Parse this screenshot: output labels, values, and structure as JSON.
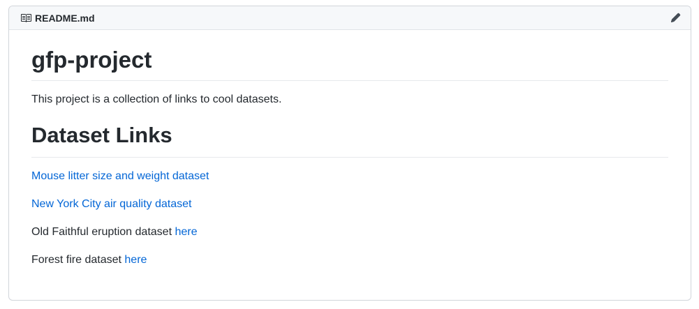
{
  "header": {
    "filename": "README.md",
    "icons": {
      "file": "book-icon",
      "edit": "pencil-icon"
    }
  },
  "readme": {
    "title": "gfp-project",
    "intro": "This project is a collection of links to cool datasets.",
    "section_heading": "Dataset Links",
    "links": [
      {
        "prefix": "",
        "link_text": "Mouse litter size and weight dataset"
      },
      {
        "prefix": "",
        "link_text": "New York City air quality dataset"
      },
      {
        "prefix": "Old Faithful eruption dataset ",
        "link_text": "here"
      },
      {
        "prefix": "Forest fire dataset ",
        "link_text": "here"
      }
    ]
  },
  "colors": {
    "link": "#0366d6",
    "text": "#24292e",
    "header_bg": "#f6f8fa",
    "border": "#d1d5da"
  }
}
